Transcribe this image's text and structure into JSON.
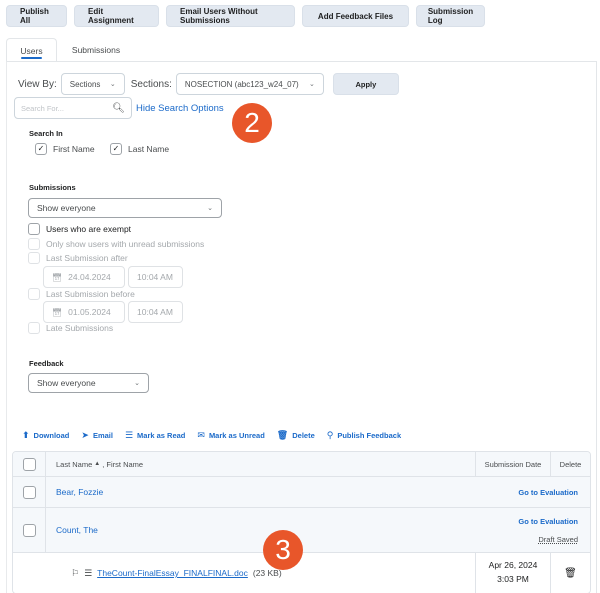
{
  "toolbar": {
    "buttons": [
      "Publish All",
      "Edit Assignment",
      "Email Users Without Submissions",
      "Add Feedback Files",
      "Submission Log"
    ]
  },
  "tabs": [
    {
      "label": "Users",
      "active": true
    },
    {
      "label": "Submissions",
      "active": false
    }
  ],
  "filters": {
    "view_by_label": "View By:",
    "view_by_value": "Sections",
    "sections_label": "Sections:",
    "sections_value": "NOSECTION (abc123_w24_07)",
    "apply_label": "Apply",
    "search_placeholder": "Search For...",
    "hide_search_options": "Hide Search Options"
  },
  "search_in": {
    "label": "Search In",
    "first_name": {
      "label": "First Name",
      "checked": true
    },
    "last_name": {
      "label": "Last Name",
      "checked": true
    }
  },
  "submissions_filter": {
    "label": "Submissions",
    "value": "Show everyone",
    "options": [
      {
        "label": "Users who are exempt",
        "checked": false,
        "enabled": true
      },
      {
        "label": "Only show users with unread submissions",
        "checked": false,
        "enabled": false
      },
      {
        "label": "Last Submission after",
        "checked": false,
        "enabled": false
      },
      {
        "label": "Last Submission before",
        "checked": false,
        "enabled": false
      },
      {
        "label": "Late Submissions",
        "checked": false,
        "enabled": false
      }
    ],
    "after_date": "24.04.2024",
    "after_time": "10:04 AM",
    "before_date": "01.05.2024",
    "before_time": "10:04 AM"
  },
  "feedback_filter": {
    "label": "Feedback",
    "value": "Show everyone"
  },
  "actions": [
    {
      "label": "Download",
      "icon": "download-icon"
    },
    {
      "label": "Email",
      "icon": "email-icon"
    },
    {
      "label": "Mark as Read",
      "icon": "mark-read-icon"
    },
    {
      "label": "Mark as Unread",
      "icon": "mark-unread-icon"
    },
    {
      "label": "Delete",
      "icon": "trash-icon"
    },
    {
      "label": "Publish Feedback",
      "icon": "publish-feedback-icon"
    }
  ],
  "table": {
    "headers": {
      "name_last": "Last Name",
      "sort_indicator": "▲",
      "name_first": ", First Name",
      "submission_date": "Submission Date",
      "delete": "Delete"
    },
    "rows": [
      {
        "name": "Bear, Fozzie",
        "eval_link": "Go to Evaluation",
        "status": ""
      },
      {
        "name": "Count, The",
        "eval_link": "Go to Evaluation",
        "status": "Draft Saved",
        "file": {
          "name": "TheCount-FinalEssay_FINALFINAL.doc",
          "size": "(23 KB)",
          "date": "Apr 26, 2024",
          "time": "3:03 PM"
        }
      }
    ]
  },
  "callouts": {
    "badge_2": "2",
    "badge_3": "3",
    "color": "#e8562a"
  },
  "colors": {
    "link": "#1b6ac9",
    "button_bg": "#e3e9f1"
  }
}
